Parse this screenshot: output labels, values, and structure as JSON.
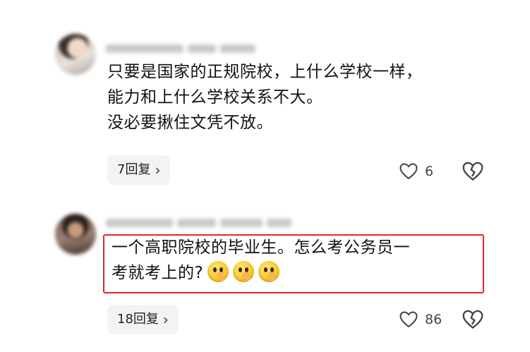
{
  "comments": [
    {
      "text_lines": [
        "只要是国家的正规院校，上什么学校一样，",
        "能力和上什么学校关系不大。",
        "没必要揪住文凭不放。"
      ],
      "reply_button": "7回复",
      "like_count": "6"
    },
    {
      "text_lines": [
        "一个高职院校的毕业生。怎么考公务员一",
        "考就考上的?"
      ],
      "reply_button": "18回复",
      "like_count": "86",
      "highlighted": true,
      "emojis": [
        "shush-emoji",
        "shush-emoji",
        "shush-emoji"
      ]
    }
  ],
  "colors": {
    "highlight_border": "#e0262b",
    "reply_bg": "#f3f3f3"
  },
  "icons": {
    "like": "heart-icon",
    "dislike": "broken-heart-icon",
    "reply_chevron": "chevron-right-icon"
  }
}
